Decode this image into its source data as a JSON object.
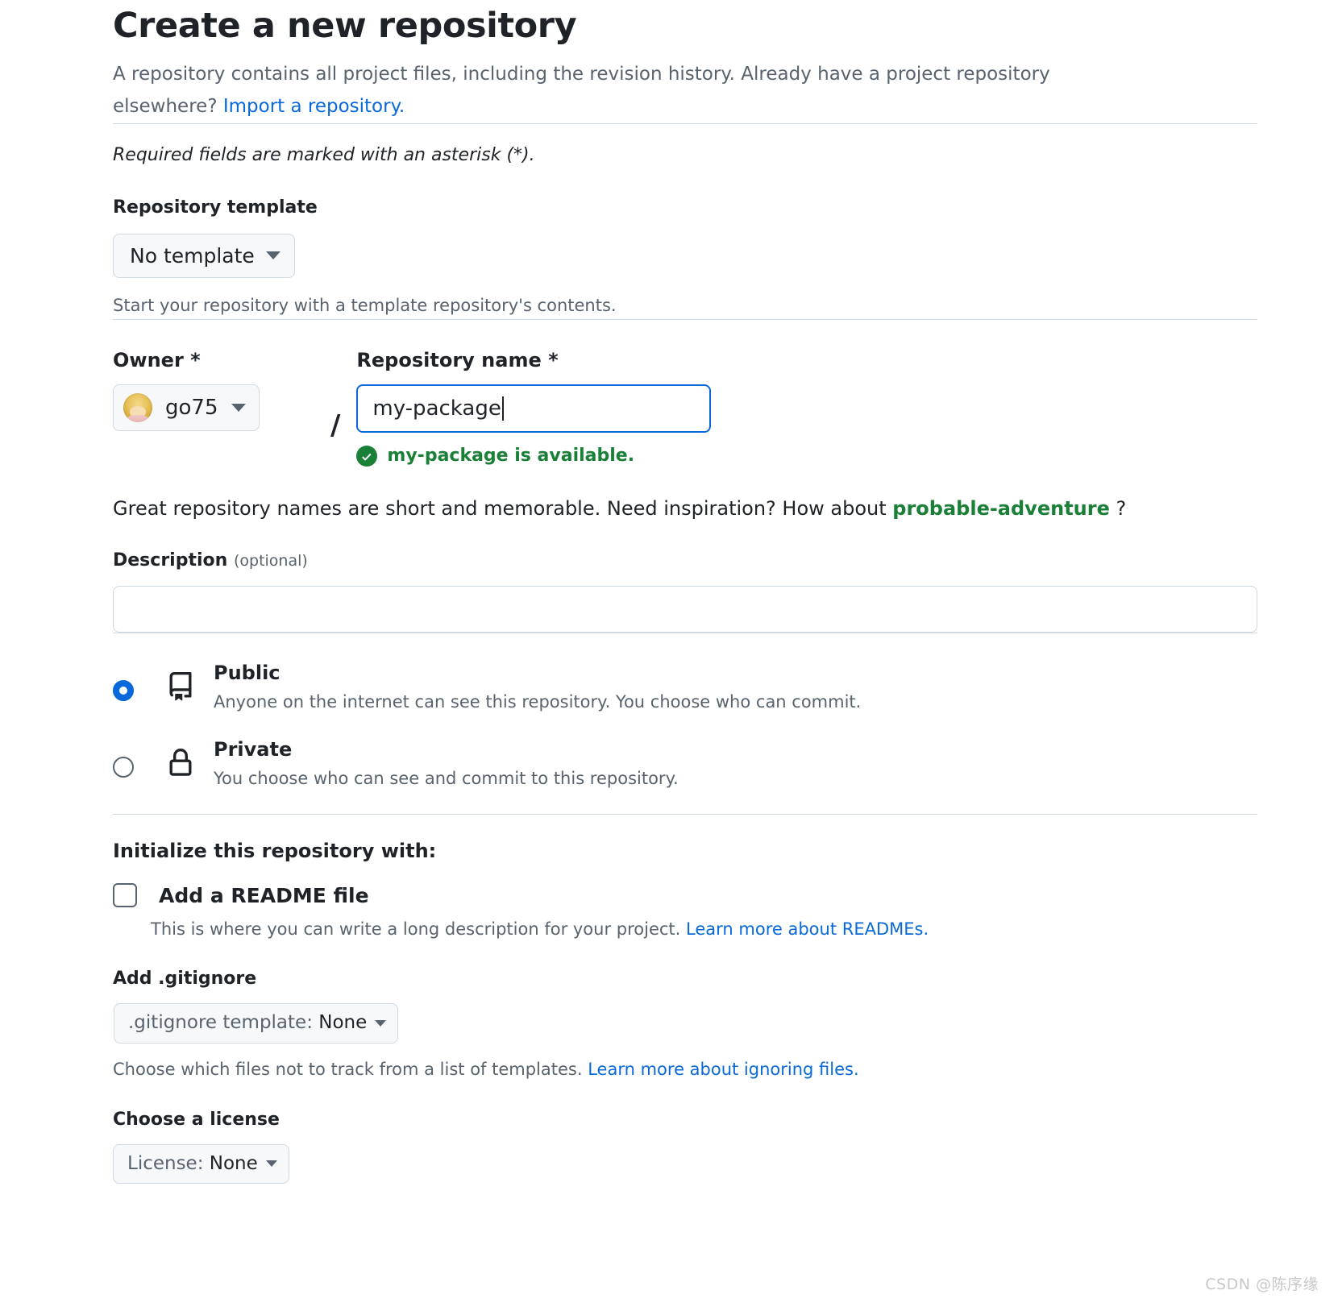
{
  "header": {
    "title": "Create a new repository",
    "description_part1": "A repository contains all project files, including the revision history. Already have a project repository elsewhere? ",
    "import_link": "Import a repository."
  },
  "required_note": "Required fields are marked with an asterisk (*).",
  "template": {
    "label": "Repository template",
    "selected": "No template",
    "helper": "Start your repository with a template repository's contents."
  },
  "owner": {
    "label": "Owner *",
    "name": "go75"
  },
  "repository_name": {
    "label": "Repository name *",
    "value": "my-package",
    "placeholder": "",
    "availability": "my-package is available."
  },
  "inspiration": {
    "prefix": "Great repository names are short and memorable. Need inspiration? How about ",
    "suggestion": "probable-adventure",
    "suffix": " ?"
  },
  "description": {
    "label": "Description",
    "optional": "(optional)",
    "value": "",
    "placeholder": ""
  },
  "visibility": {
    "options": [
      {
        "title": "Public",
        "description": "Anyone on the internet can see this repository. You choose who can commit.",
        "icon": "repo-icon",
        "selected": true
      },
      {
        "title": "Private",
        "description": "You choose who can see and commit to this repository.",
        "icon": "lock-icon",
        "selected": false
      }
    ]
  },
  "initialize": {
    "title": "Initialize this repository with:",
    "readme": {
      "label": "Add a README file",
      "checked": false,
      "help_text": "This is where you can write a long description for your project. ",
      "help_link": "Learn more about READMEs."
    },
    "gitignore": {
      "label": "Add .gitignore",
      "button_prefix": ".gitignore template: ",
      "button_value": "None",
      "help_text": "Choose which files not to track from a list of templates. ",
      "help_link": "Learn more about ignoring files."
    },
    "license": {
      "label": "Choose a license",
      "button_prefix": "License: ",
      "button_value": "None"
    }
  },
  "watermark": "CSDN @陈序缘",
  "colors": {
    "accent": "#0969da",
    "success": "#1a7f37",
    "muted": "#59636e",
    "border": "#d1d9e0"
  }
}
